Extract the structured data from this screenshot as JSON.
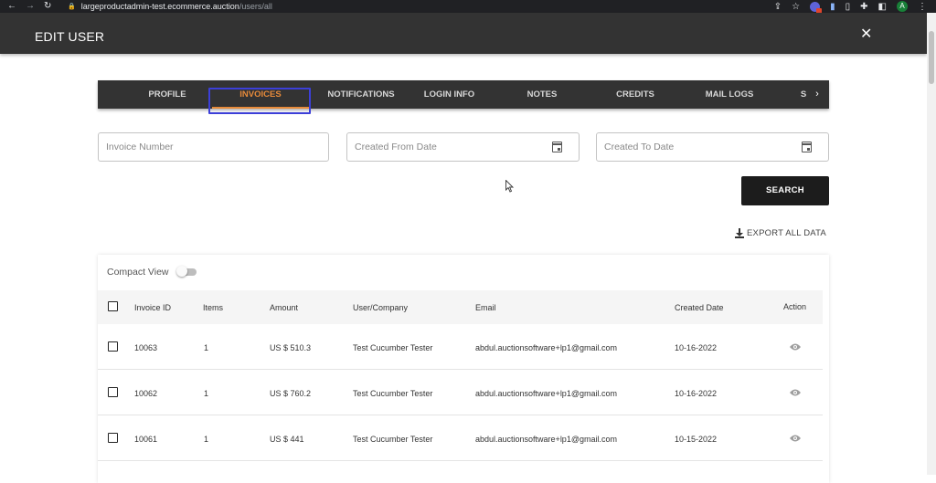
{
  "browser": {
    "url_host": "largeproductadmin-test.ecommerce.auction",
    "url_path": "/users/all",
    "avatar_letter": "A"
  },
  "header": {
    "title": "EDIT USER",
    "close_glyph": "✕"
  },
  "tabs": [
    {
      "label": "PROFILE",
      "active": false
    },
    {
      "label": "INVOICES",
      "active": true
    },
    {
      "label": "NOTIFICATIONS",
      "active": false
    },
    {
      "label": "LOGIN INFO",
      "active": false
    },
    {
      "label": "NOTES",
      "active": false
    },
    {
      "label": "CREDITS",
      "active": false
    },
    {
      "label": "MAIL LOGS",
      "active": false
    },
    {
      "label": "S",
      "active": false
    }
  ],
  "filters": {
    "invoice_number_placeholder": "Invoice Number",
    "created_from_placeholder": "Created From Date",
    "created_to_placeholder": "Created To Date",
    "search_label": "SEARCH",
    "export_label": "EXPORT ALL DATA"
  },
  "table": {
    "compact_view_label": "Compact View",
    "compact_view_on": false,
    "columns": [
      "Invoice ID",
      "Items",
      "Amount",
      "User/Company",
      "Email",
      "Created Date",
      "Action"
    ],
    "rows": [
      {
        "invoice_id": "10063",
        "items": "1",
        "amount": "US $ 510.3",
        "user_company": "Test Cucumber Tester",
        "email": "abdul.auctionsoftware+lp1@gmail.com",
        "created_date": "10-16-2022",
        "action_icon": "eye-icon"
      },
      {
        "invoice_id": "10062",
        "items": "1",
        "amount": "US $ 760.2",
        "user_company": "Test Cucumber Tester",
        "email": "abdul.auctionsoftware+lp1@gmail.com",
        "created_date": "10-16-2022",
        "action_icon": "eye-icon"
      },
      {
        "invoice_id": "10061",
        "items": "1",
        "amount": "US $ 441",
        "user_company": "Test Cucumber Tester",
        "email": "abdul.auctionsoftware+lp1@gmail.com",
        "created_date": "10-15-2022",
        "action_icon": "eye-icon"
      }
    ]
  },
  "colors": {
    "header_bg": "#333333",
    "tab_active": "#e68a3a",
    "focus_outline": "#3c3fd8",
    "search_button_bg": "#1c1c1c"
  }
}
